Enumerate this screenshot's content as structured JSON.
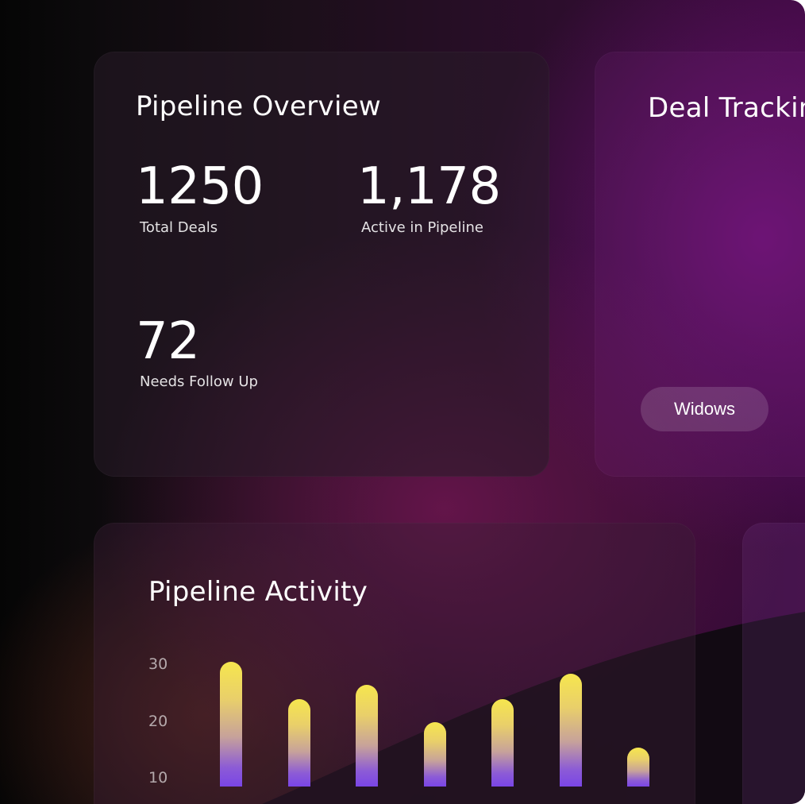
{
  "pipeline_overview": {
    "title": "Pipeline Overview",
    "stats": [
      {
        "value": "1250",
        "label": "Total Deals"
      },
      {
        "value": "1,178",
        "label": "Active in Pipeline"
      },
      {
        "value": "72",
        "label": "Needs Follow Up"
      }
    ]
  },
  "deal_tracking": {
    "title": "Deal Tracking",
    "pill_label": "Widows"
  },
  "pipeline_activity": {
    "title": "Pipeline Activity"
  },
  "chart_data": {
    "type": "bar",
    "values": [
      30.5,
      24,
      26.5,
      20,
      24,
      28.5,
      15.5
    ],
    "y_ticks": [
      "30",
      "20",
      "10"
    ],
    "ylim": [
      5,
      30
    ],
    "bar_gradient": [
      "#f6e64e",
      "#7a45e6"
    ]
  },
  "colors": {
    "accent_purple": "#7a45e6",
    "accent_yellow": "#f6e64e",
    "background_dark": "#0c0a0c"
  }
}
